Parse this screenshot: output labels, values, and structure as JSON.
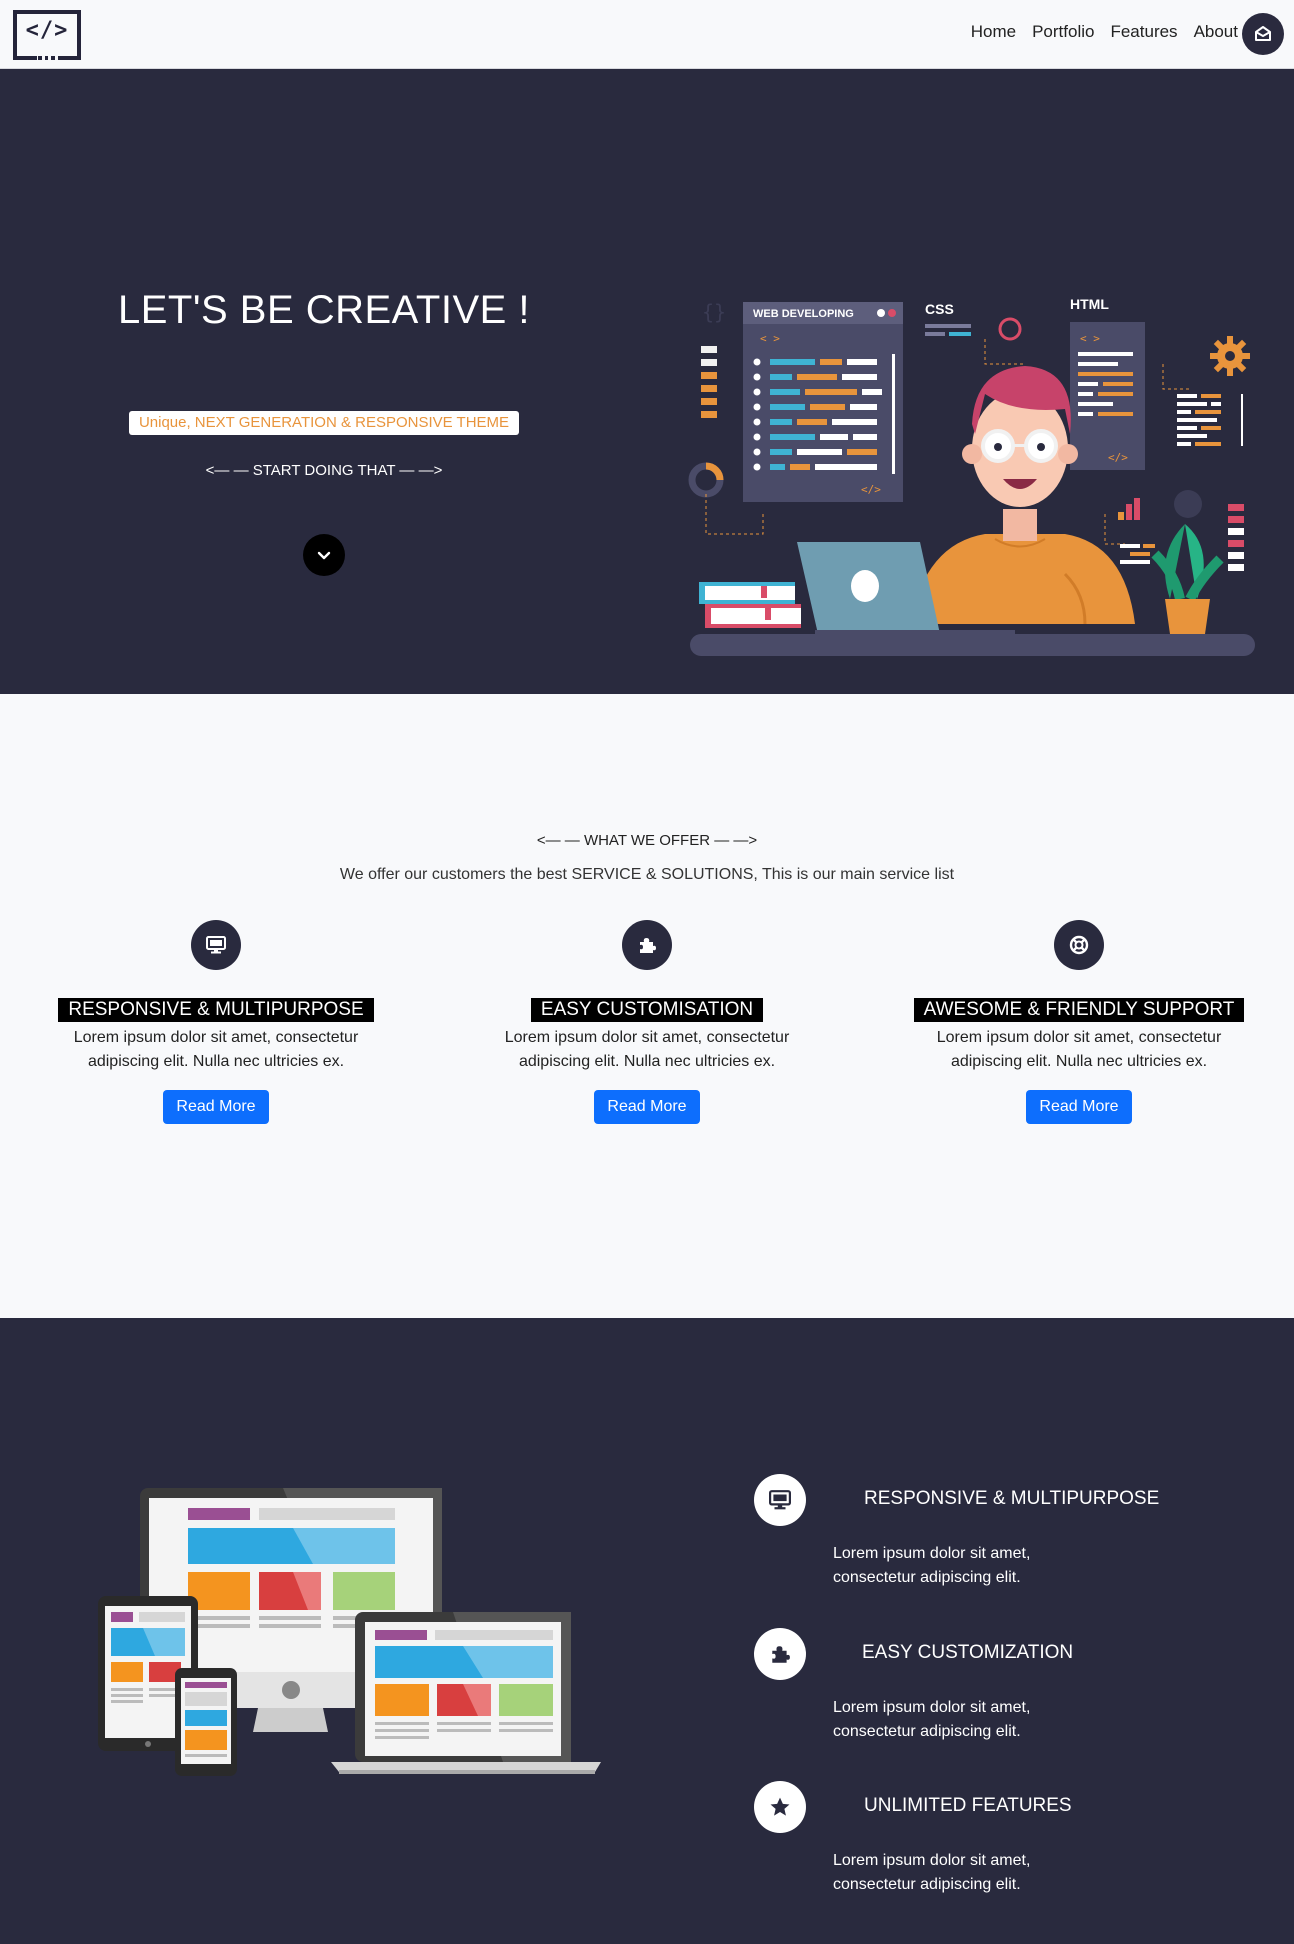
{
  "nav": {
    "links": [
      "Home",
      "Portfolio",
      "Features",
      "About"
    ],
    "logo_text": "</>"
  },
  "hero": {
    "title": "LET'S BE CREATIVE !",
    "subtitle": "Unique, NEXT GENERATION & RESPONSIVE THEME",
    "cta": "<— — START DOING THAT — —>",
    "art_labels": {
      "web": "WEB DEVELOPING",
      "css": "CSS",
      "html": "HTML"
    }
  },
  "offer": {
    "heading": "<— — WHAT WE OFFER — —>",
    "description": "We offer our customers the best SERVICE & SOLUTIONS, This is our main service list",
    "services": [
      {
        "icon": "desktop-icon",
        "title": "RESPONSIVE & MULTIPURPOSE",
        "text": "Lorem ipsum dolor sit amet, consectetur adipiscing elit. Nulla nec ultricies ex.",
        "button": "Read More"
      },
      {
        "icon": "puzzle-icon",
        "title": "EASY CUSTOMISATION",
        "text": "Lorem ipsum dolor sit amet, consectetur adipiscing elit. Nulla nec ultricies ex.",
        "button": "Read More"
      },
      {
        "icon": "lifebuoy-icon",
        "title": "AWESOME & FRIENDLY SUPPORT",
        "text": "Lorem ipsum dolor sit amet, consectetur adipiscing elit. Nulla nec ultricies ex.",
        "button": "Read More"
      }
    ]
  },
  "features": {
    "items": [
      {
        "icon": "desktop-icon",
        "title": "RESPONSIVE & MULTIPURPOSE",
        "text": "Lorem ipsum dolor sit amet, consectetur adipiscing elit."
      },
      {
        "icon": "puzzle-icon",
        "title": "EASY CUSTOMIZATION",
        "text": "Lorem ipsum dolor sit amet, consectetur adipiscing elit."
      },
      {
        "icon": "star-icon",
        "title": "UNLIMITED FEATURES",
        "text": "Lorem ipsum dolor sit amet, consectetur adipiscing elit."
      }
    ]
  },
  "colors": {
    "dark": "#292a3e",
    "accent_orange": "#e8943c",
    "button_blue": "#0d6efd"
  }
}
